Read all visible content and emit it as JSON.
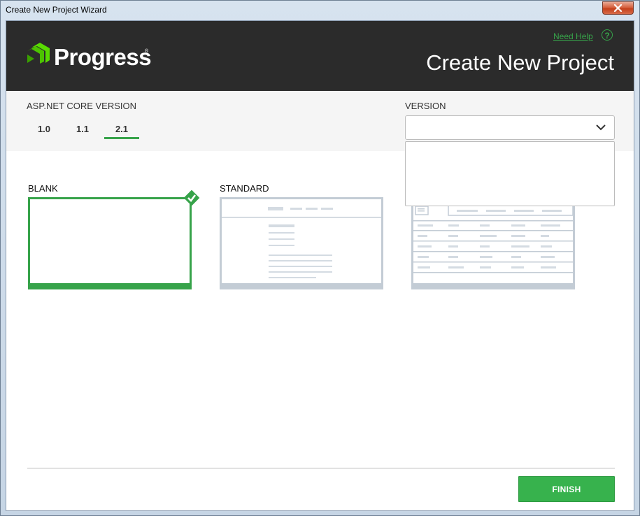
{
  "window": {
    "title": "Create New Project Wizard"
  },
  "header": {
    "logo_text": "Progress",
    "logo_reg": "®",
    "help_link": "Need Help",
    "help_icon_glyph": "?",
    "title": "Create New Project"
  },
  "aspnet": {
    "label": "ASP.NET CORE VERSION",
    "versions": [
      "1.0",
      "1.1",
      "2.1"
    ],
    "selected": "2.1"
  },
  "version": {
    "label": "VERSION",
    "selected_value": "",
    "dropdown_open": true
  },
  "templates": [
    {
      "label": "BLANK",
      "selected": true
    },
    {
      "label": "STANDARD",
      "selected": false
    },
    {
      "label": "",
      "selected": false
    }
  ],
  "footer": {
    "finish_label": "FINISH"
  },
  "colors": {
    "accent": "#37b24d",
    "header_bg": "#2b2b2b",
    "band_bg": "#f5f5f5"
  }
}
